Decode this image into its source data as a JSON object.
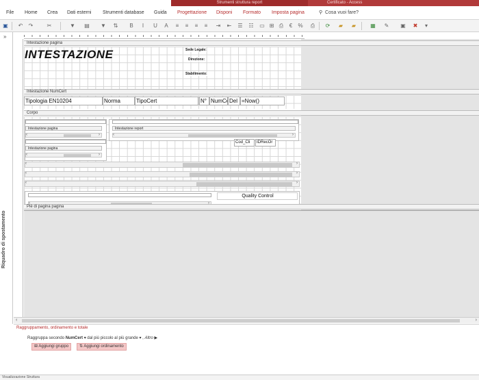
{
  "titlebar": {
    "contextual_group": "Strumenti struttura report",
    "app_title": "Certificato - Access"
  },
  "tabs": [
    {
      "label": "File"
    },
    {
      "label": "Home"
    },
    {
      "label": "Crea"
    },
    {
      "label": "Dati esterni"
    },
    {
      "label": "Strumenti database"
    },
    {
      "label": "Guida"
    },
    {
      "label": "Progettazione"
    },
    {
      "label": "Disponi"
    },
    {
      "label": "Formato"
    },
    {
      "label": "Imposta pagina"
    }
  ],
  "tell_me": "Cosa vuoi fare?",
  "nav_pane": {
    "label": "Riquadro di spostamento",
    "toggle": "»"
  },
  "sections": {
    "page_header": "Intestazione pagina",
    "numcert_header": "Intestazione NumCert",
    "body": "Corpo",
    "page_footer": "Piè di pagina pagina"
  },
  "header_content": {
    "title": "INTESTAZIONE",
    "labels": [
      "Sede Legale:",
      "Direzione:",
      "Stabilimento:"
    ]
  },
  "numcert_fields": [
    "Tipologia EN10204",
    "Norma",
    "TipoCert",
    "N°",
    "NumCe",
    "Del",
    "=Now()"
  ],
  "subreports": {
    "sub1_header": "Intestazione pagina",
    "sub2_header": "Intestazione report",
    "sub3_header": "Intestazione pagina",
    "fields": [
      "Cod_Cli",
      "IDRecOr"
    ],
    "quality_label": "Quality Control"
  },
  "grouping": {
    "title": "Raggruppamento, ordinamento e totale",
    "row": {
      "prefix": "Raggruppa secondo",
      "field": "NumCert",
      "order": "dal più piccolo al più grande",
      "more": "Altro ▶"
    },
    "add_group": "Aggiungi gruppo",
    "add_sort": "Aggiungi ordinamento"
  },
  "statusbar": {
    "text": "Visualizzazione Struttura"
  },
  "colors": {
    "accent": "#b13a3a",
    "contextual_tab_text": "#b52b2b",
    "button_fill": "#f4c7c7"
  }
}
